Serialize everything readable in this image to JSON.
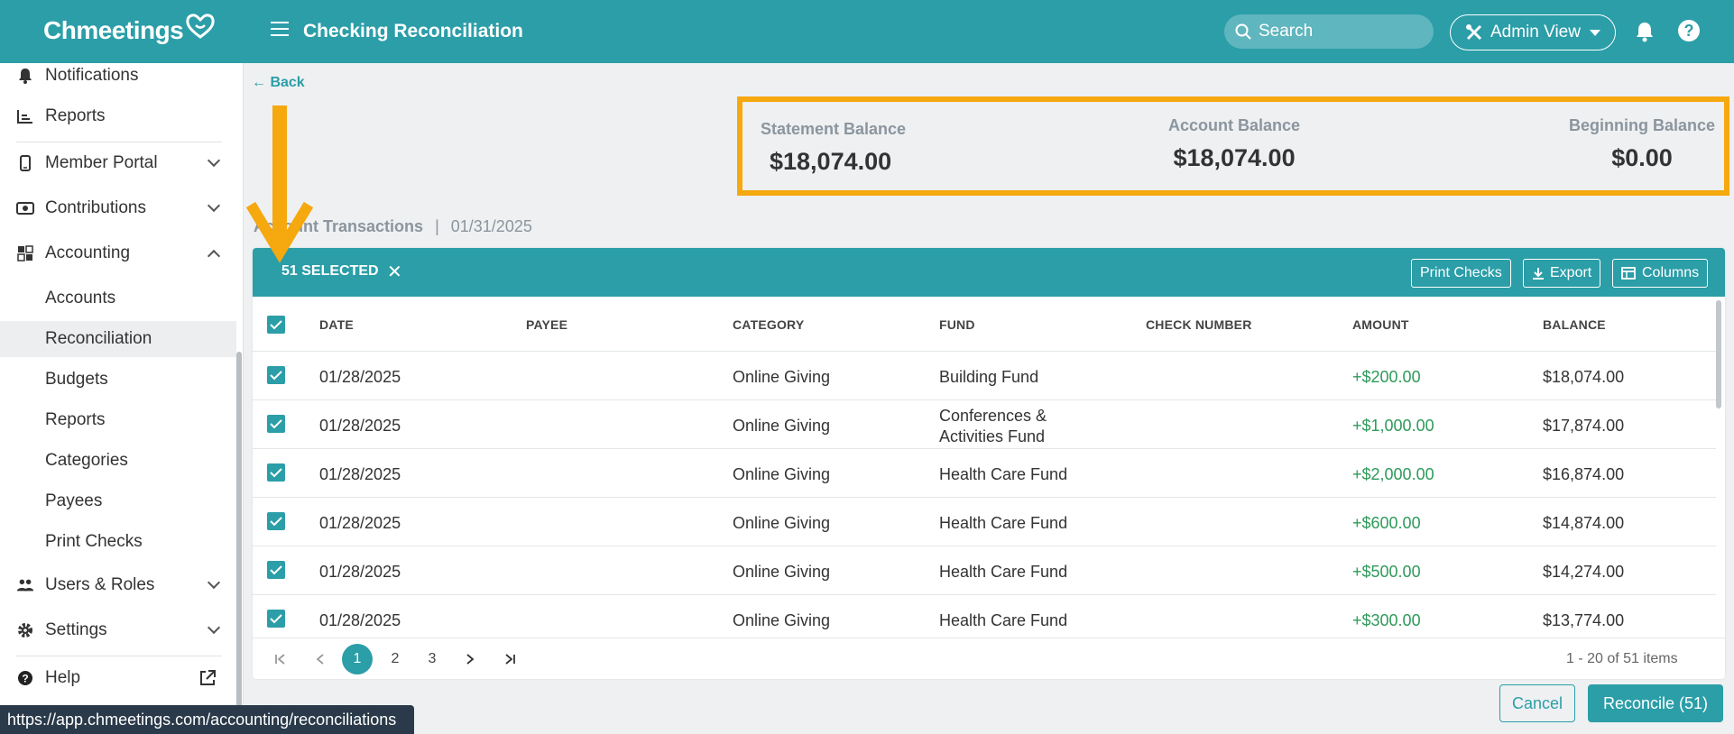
{
  "header": {
    "logo_text": "Chmeetings",
    "title": "Checking Reconciliation",
    "search_placeholder": "Search",
    "admin_view_label": "Admin View",
    "help_label": "?"
  },
  "sidebar": {
    "notifications": "Notifications",
    "reports_top": "Reports",
    "member_portal": "Member Portal",
    "contributions": "Contributions",
    "accounting": "Accounting",
    "accounting_sub": [
      "Accounts",
      "Reconciliation",
      "Budgets",
      "Reports",
      "Categories",
      "Payees",
      "Print Checks"
    ],
    "users_roles": "Users & Roles",
    "settings": "Settings",
    "help": "Help",
    "active_sub": "Reconciliation"
  },
  "status_url": "https://app.chmeetings.com/accounting/reconciliations",
  "back_label": "Back",
  "balances": {
    "statement_label": "Statement Balance",
    "statement_value": "$18,074.00",
    "account_label": "Account Balance",
    "account_value": "$18,074.00",
    "beginning_label": "Beginning Balance",
    "beginning_value": "$0.00"
  },
  "transactions_title": "Account Transactions",
  "transactions_separator": "|",
  "transactions_date": "01/31/2025",
  "toolbar": {
    "selected_label": "51 SELECTED",
    "print_checks": "Print Checks",
    "export": "Export",
    "columns": "Columns"
  },
  "table": {
    "columns": [
      "DATE",
      "PAYEE",
      "CATEGORY",
      "FUND",
      "CHECK NUMBER",
      "AMOUNT",
      "BALANCE"
    ],
    "rows": [
      {
        "date": "01/28/2025",
        "payee": "",
        "category": "Online Giving",
        "fund": "Building Fund",
        "fund2": "",
        "check": "",
        "amount": "+$200.00",
        "balance": "$18,074.00"
      },
      {
        "date": "01/28/2025",
        "payee": "",
        "category": "Online Giving",
        "fund": "Conferences &",
        "fund2": "Activities Fund",
        "check": "",
        "amount": "+$1,000.00",
        "balance": "$17,874.00"
      },
      {
        "date": "01/28/2025",
        "payee": "",
        "category": "Online Giving",
        "fund": "Health Care Fund",
        "fund2": "",
        "check": "",
        "amount": "+$2,000.00",
        "balance": "$16,874.00"
      },
      {
        "date": "01/28/2025",
        "payee": "",
        "category": "Online Giving",
        "fund": "Health Care Fund",
        "fund2": "",
        "check": "",
        "amount": "+$600.00",
        "balance": "$14,874.00"
      },
      {
        "date": "01/28/2025",
        "payee": "",
        "category": "Online Giving",
        "fund": "Health Care Fund",
        "fund2": "",
        "check": "",
        "amount": "+$500.00",
        "balance": "$14,274.00"
      },
      {
        "date": "01/28/2025",
        "payee": "",
        "category": "Online Giving",
        "fund": "Health Care Fund",
        "fund2": "",
        "check": "",
        "amount": "+$300.00",
        "balance": "$13,774.00"
      }
    ]
  },
  "pager": {
    "pages": [
      "1",
      "2",
      "3"
    ],
    "current_page": "1",
    "info": "1 - 20 of 51 items"
  },
  "actions": {
    "cancel": "Cancel",
    "reconcile": "Reconcile (51)"
  },
  "colors": {
    "brand": "#2b9ea8",
    "highlight": "#f6a80f",
    "positive": "#2e9a5a"
  }
}
